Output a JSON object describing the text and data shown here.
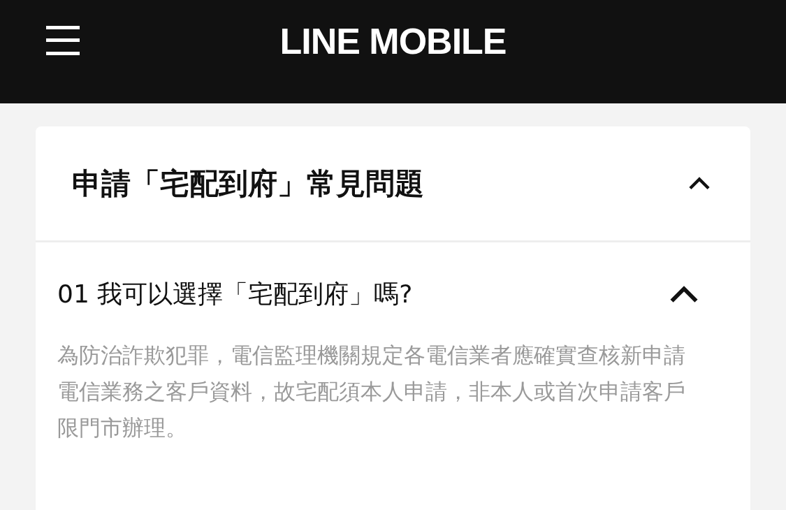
{
  "header": {
    "logo": "LINE MOBILE"
  },
  "section": {
    "title": "申請「宅配到府」常見問題",
    "expanded": true,
    "questions": [
      {
        "number": "01",
        "question": "我可以選擇「宅配到府」嗎?",
        "expanded": true,
        "answer": "為防治詐欺犯罪，電信監理機關規定各電信業者應確實查核新申請電信業務之客戶資料，故宅配須本人申請，非本人或首次申請客戶限門市辦理。"
      }
    ]
  }
}
